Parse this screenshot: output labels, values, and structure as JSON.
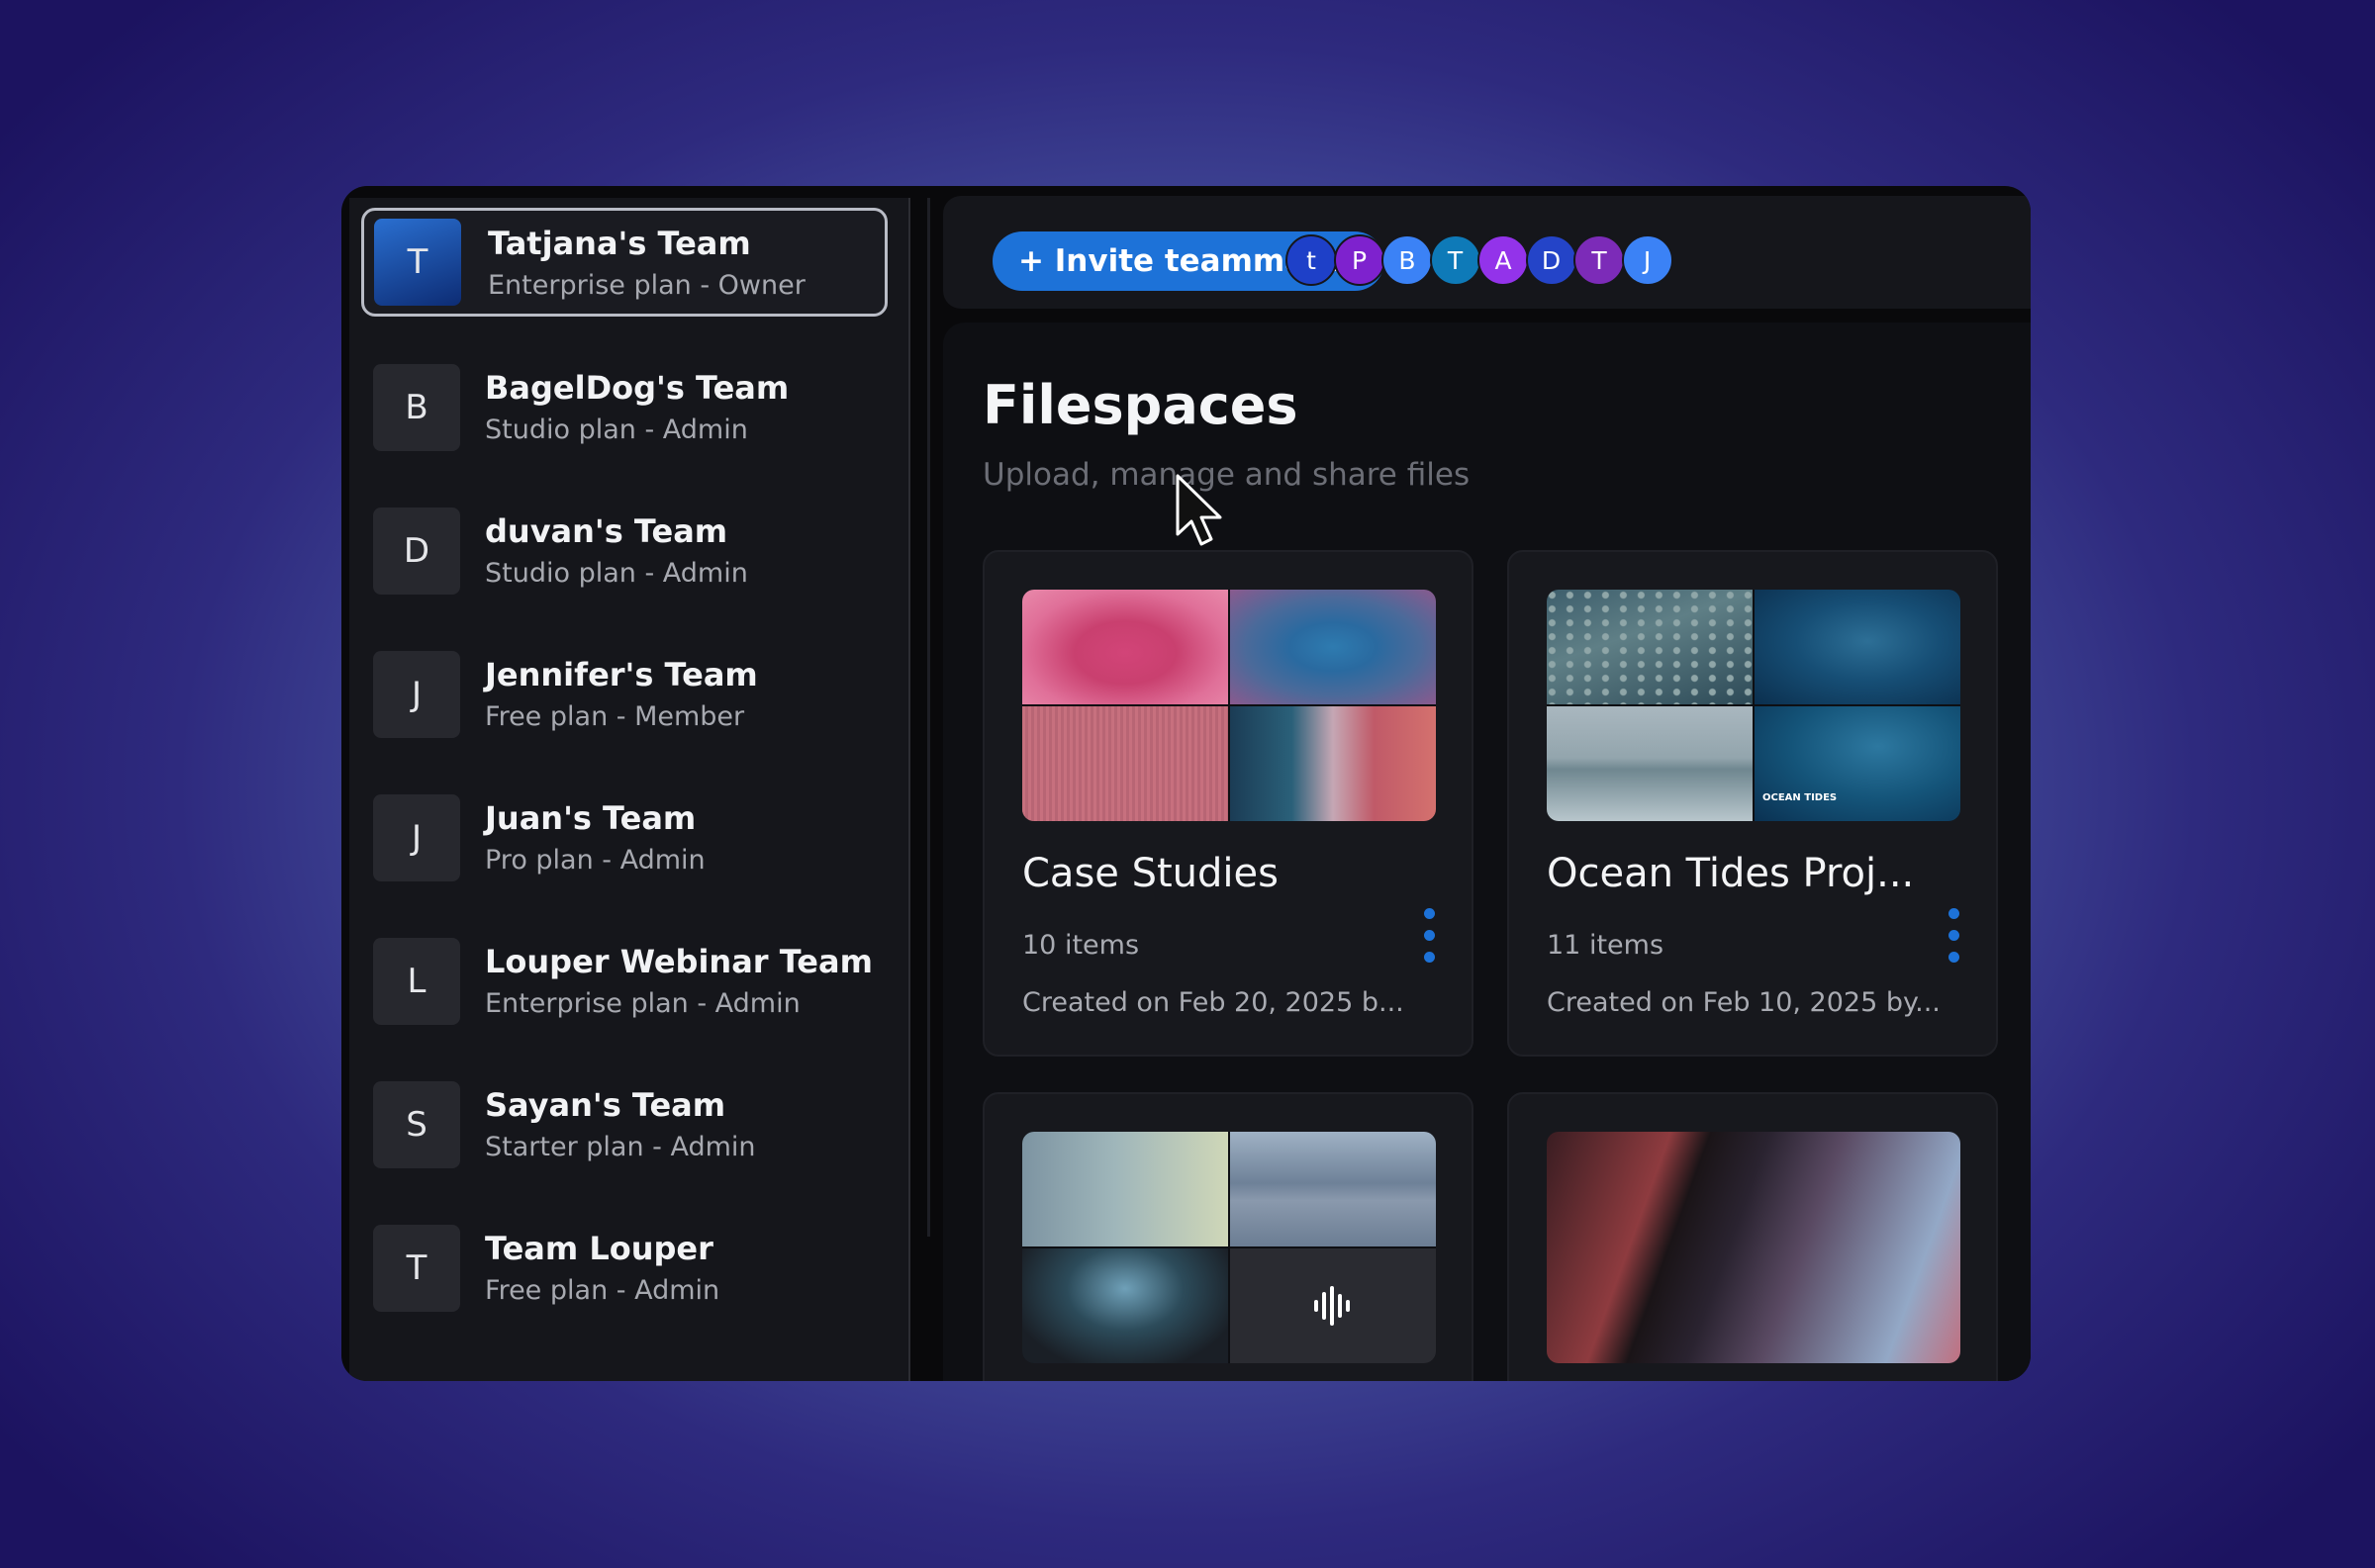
{
  "teams": [
    {
      "initial": "T",
      "name": "Tatjana's Team",
      "plan": "Enterprise plan - Owner"
    },
    {
      "initial": "B",
      "name": "BagelDog's Team",
      "plan": "Studio plan - Admin"
    },
    {
      "initial": "D",
      "name": "duvan's Team",
      "plan": "Studio plan - Admin"
    },
    {
      "initial": "J",
      "name": "Jennifer's Team",
      "plan": "Free plan - Member"
    },
    {
      "initial": "J",
      "name": "Juan's Team",
      "plan": "Pro plan - Admin"
    },
    {
      "initial": "L",
      "name": "Louper Webinar Team",
      "plan": "Enterprise plan - Admin"
    },
    {
      "initial": "S",
      "name": "Sayan's Team",
      "plan": "Starter plan - Admin"
    },
    {
      "initial": "T",
      "name": "Team Louper",
      "plan": "Free plan - Admin"
    }
  ],
  "topbar": {
    "invite_label": "+ Invite teammates",
    "members": [
      {
        "initial": "t",
        "color": "#1e40c8"
      },
      {
        "initial": "P",
        "color": "#7e22ce"
      },
      {
        "initial": "B",
        "color": "#3b82f6"
      },
      {
        "initial": "T",
        "color": "#0e7ab8"
      },
      {
        "initial": "A",
        "color": "#9333ea"
      },
      {
        "initial": "D",
        "color": "#2444c8"
      },
      {
        "initial": "T",
        "color": "#7c2bb8"
      },
      {
        "initial": "J",
        "color": "#3b82f6"
      }
    ]
  },
  "main": {
    "title": "Filespaces",
    "subtitle": "Upload, manage and share files",
    "cards": [
      {
        "title": "Case Studies",
        "items": "10 items",
        "created": "Created on Feb 20, 2025 b..."
      },
      {
        "title": "Ocean Tides Proj...",
        "items": "11 items",
        "created": "Created on Feb 10, 2025 by...",
        "thumb_caption": "OCEAN TIDES"
      }
    ]
  },
  "colors": {
    "accent": "#1d72d8",
    "background": "#09090b"
  }
}
